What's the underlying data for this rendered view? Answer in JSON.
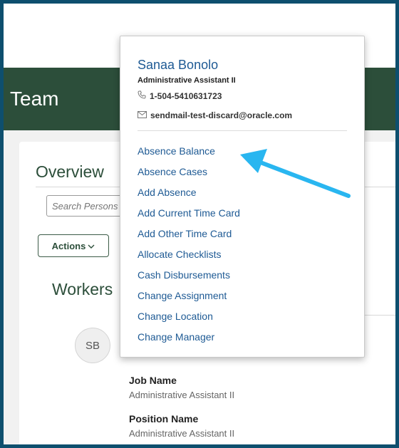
{
  "header": {
    "title": "Team"
  },
  "overview": {
    "title": "Overview",
    "search_placeholder": "Search Persons",
    "actions_label": "Actions"
  },
  "workers": {
    "title": "Workers",
    "person": {
      "initials": "SB",
      "fields": [
        {
          "label": "Job Name",
          "value": "Administrative Assistant II"
        },
        {
          "label": "Position Name",
          "value": "Administrative Assistant II"
        }
      ]
    }
  },
  "popup": {
    "name": "Sanaa Bonolo",
    "role": "Administrative Assistant II",
    "phone": "1-504-5410631723",
    "email": "sendmail-test-discard@oracle.com",
    "menu": [
      "Absence Balance",
      "Absence Cases",
      "Add Absence",
      "Add Current Time Card",
      "Add Other Time Card",
      "Allocate Checklists",
      "Cash Disbursements",
      "Change Assignment",
      "Change Location",
      "Change Manager"
    ]
  },
  "colors": {
    "frame_border": "#0e4f6e",
    "header_green": "#2c4e3a",
    "link_blue": "#1e5a94",
    "arrow_cyan": "#29b6f0"
  },
  "icons": {
    "phone": "phone-icon",
    "email": "envelope-icon",
    "actions_chevron": "chevron-down-icon"
  }
}
